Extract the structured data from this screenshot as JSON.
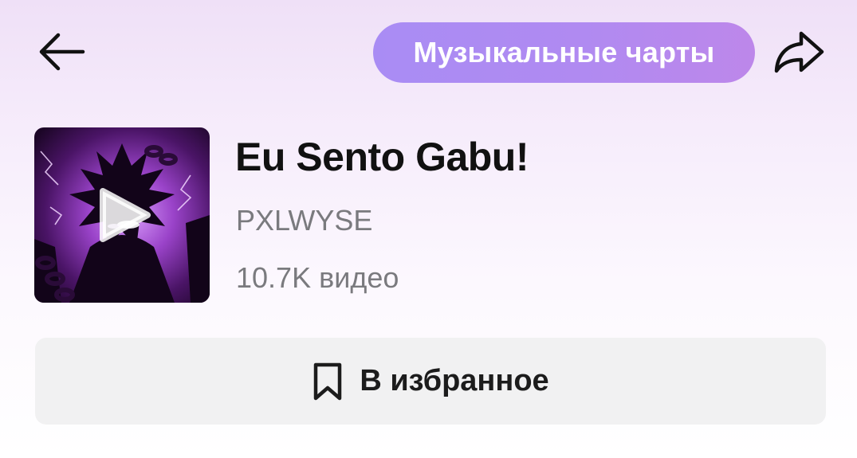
{
  "header": {
    "back_icon": "arrow-left-icon",
    "chart_label": "Музыкальные чарты",
    "share_icon": "share-arrow-icon"
  },
  "song": {
    "title": "Eu Sento Gabu!",
    "artist": "PXLWYSE",
    "video_count": "10.7K видео",
    "cover_play_icon": "play-icon"
  },
  "favorite": {
    "label": "В избранное",
    "icon": "bookmark-icon"
  },
  "colors": {
    "pill_start": "#a98cf4",
    "pill_end": "#bd87ea",
    "cover_accent": "#b25cf0",
    "secondary_text": "#7a7a7e"
  }
}
